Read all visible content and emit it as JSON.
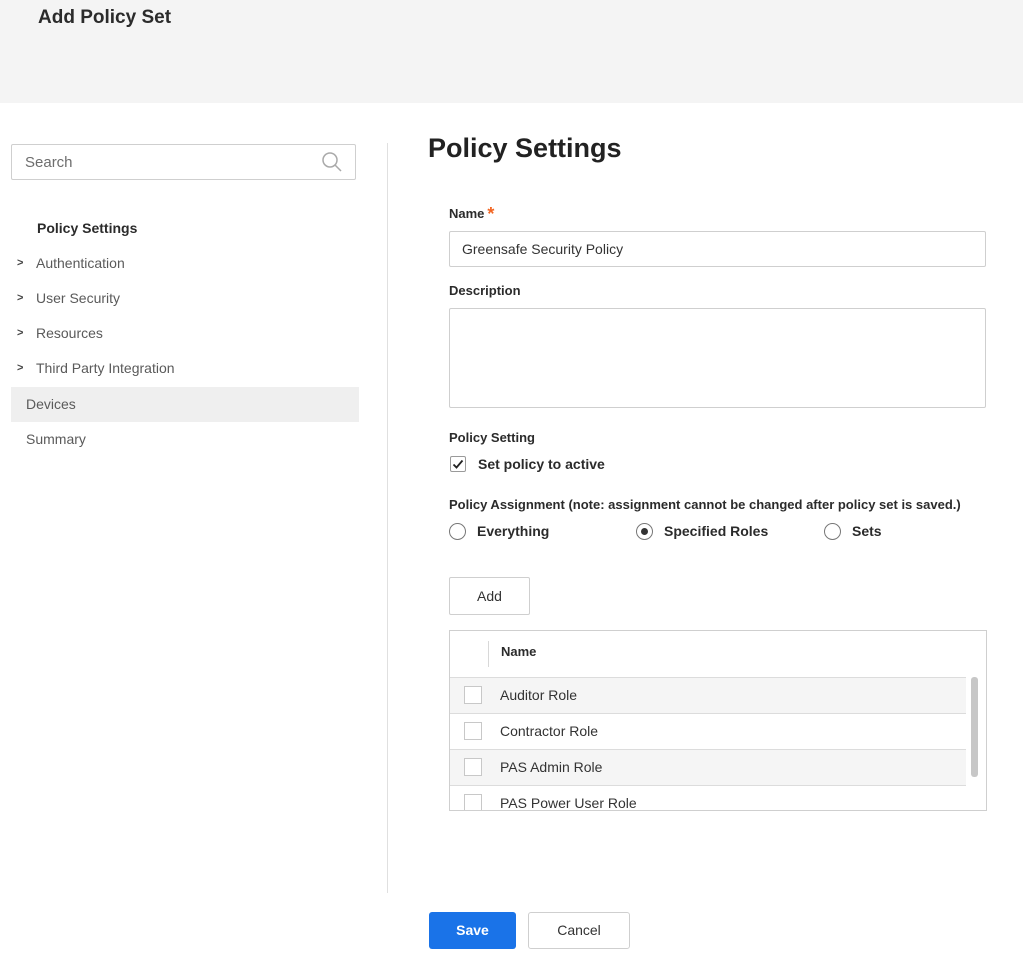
{
  "header": {
    "title": "Add Policy Set"
  },
  "sidebar": {
    "search_placeholder": "Search",
    "heading": "Policy Settings",
    "items": [
      {
        "label": "Authentication",
        "expandable": true
      },
      {
        "label": "User Security",
        "expandable": true
      },
      {
        "label": "Resources",
        "expandable": true
      },
      {
        "label": "Third Party Integration",
        "expandable": true
      },
      {
        "label": "Devices",
        "expandable": false,
        "active": true
      },
      {
        "label": "Summary",
        "expandable": false
      }
    ]
  },
  "main": {
    "title": "Policy Settings",
    "name_label": "Name",
    "required_mark": "*",
    "name_value": "Greensafe Security Policy",
    "description_label": "Description",
    "description_value": "",
    "policy_setting_label": "Policy Setting",
    "active_checkbox": {
      "label": "Set policy to active",
      "checked": true
    },
    "assignment_label": "Policy Assignment (note: assignment cannot be changed after policy set is saved.)",
    "assignment_options": [
      {
        "label": "Everything",
        "selected": false
      },
      {
        "label": "Specified Roles",
        "selected": true
      },
      {
        "label": "Sets",
        "selected": false
      }
    ],
    "add_button": "Add",
    "roles_table": {
      "header": "Name",
      "rows": [
        "Auditor Role",
        "Contractor Role",
        "PAS Admin Role",
        "PAS Power User Role"
      ]
    }
  },
  "footer": {
    "save_label": "Save",
    "cancel_label": "Cancel"
  },
  "colors": {
    "primary": "#1a73e8",
    "required": "#f26522",
    "header_bg": "#f4f4f4"
  }
}
